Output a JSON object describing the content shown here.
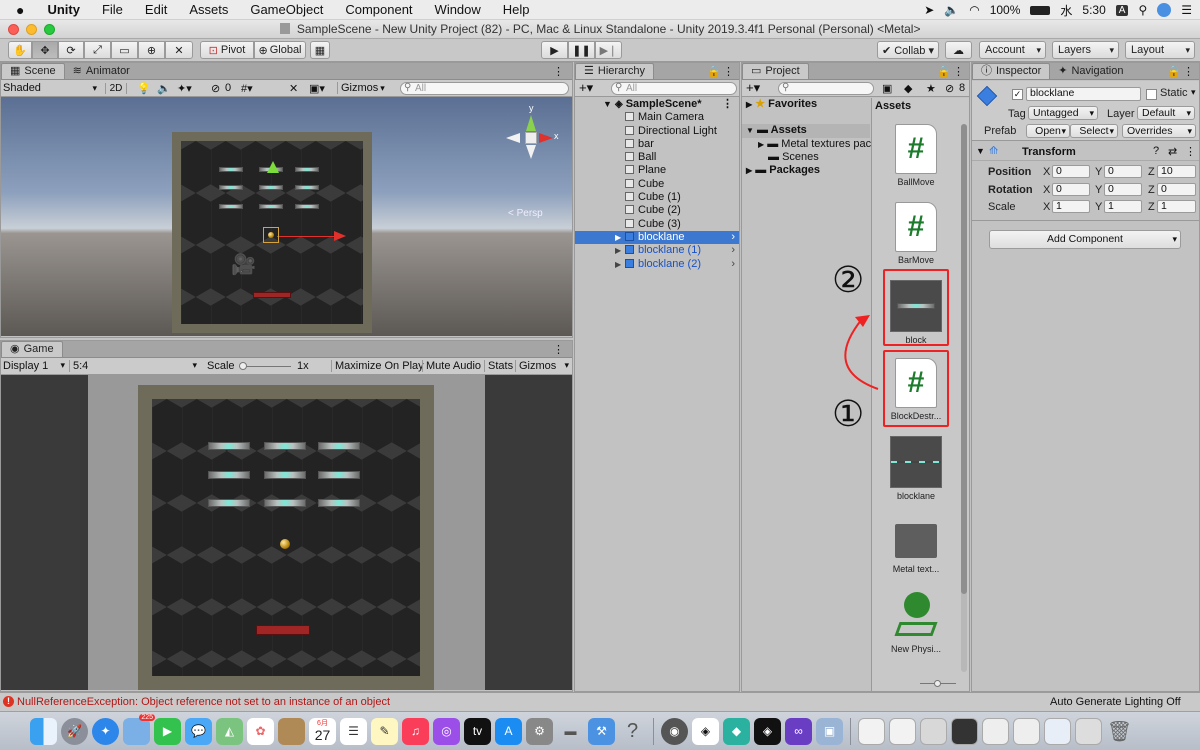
{
  "menubar": {
    "apple": "",
    "items": [
      "Unity",
      "File",
      "Edit",
      "Assets",
      "GameObject",
      "Component",
      "Window",
      "Help"
    ],
    "status": {
      "battery": "100%",
      "day": "水",
      "time": "5:30",
      "input": "A"
    }
  },
  "window": {
    "title": "SampleScene - New Unity Project (82) - PC, Mac & Linux Standalone - Unity 2019.3.4f1 Personal (Personal) <Metal>"
  },
  "toolbar": {
    "pivot": "Pivot",
    "global": "Global",
    "collab": "Collab ▾",
    "account": "Account",
    "layers": "Layers",
    "layout": "Layout"
  },
  "scene_panel": {
    "tabs": [
      "Scene",
      "Animator"
    ],
    "shading": "Shaded",
    "mode_2d": "2D",
    "hidden_count": "0",
    "gizmos": "Gizmos",
    "search_placeholder": "All",
    "persp_label": "< Persp"
  },
  "game_panel": {
    "tab": "Game",
    "display": "Display 1",
    "aspect": "5:4",
    "scale_label": "Scale",
    "scale_value": "1x",
    "maximize": "Maximize On Play",
    "mute": "Mute Audio",
    "stats": "Stats",
    "gizmos": "Gizmos"
  },
  "hierarchy": {
    "tab": "Hierarchy",
    "search_placeholder": "All",
    "scene": "SampleScene*",
    "items": [
      {
        "label": "Main Camera"
      },
      {
        "label": "Directional Light"
      },
      {
        "label": "bar"
      },
      {
        "label": "Ball"
      },
      {
        "label": "Plane"
      },
      {
        "label": "Cube"
      },
      {
        "label": "Cube (1)"
      },
      {
        "label": "Cube (2)"
      },
      {
        "label": "Cube (3)"
      }
    ],
    "prefabs": [
      {
        "label": "blocklane"
      },
      {
        "label": "blocklane (1)"
      },
      {
        "label": "blocklane (2)"
      }
    ]
  },
  "project": {
    "tab": "Project",
    "hidden_count": "8",
    "favorites": "Favorites",
    "assets_root": "Assets",
    "tree": [
      "Metal textures pac",
      "Scenes"
    ],
    "packages": "Packages",
    "grid_title": "Assets",
    "assets": [
      "BallMove",
      "BarMove",
      "block",
      "BlockDestr...",
      "blocklane",
      "Metal text...",
      "New Physi..."
    ],
    "annotations": {
      "first": "①",
      "second": "②"
    }
  },
  "inspector": {
    "tabs": [
      "Inspector",
      "Navigation"
    ],
    "object_name": "blocklane",
    "static_label": "Static",
    "tag_label": "Tag",
    "tag_value": "Untagged",
    "layer_label": "Layer",
    "layer_value": "Default",
    "prefab_label": "Prefab",
    "open": "Open",
    "select": "Select",
    "overrides": "Overrides",
    "transform_title": "Transform",
    "position_label": "Position",
    "rotation_label": "Rotation",
    "scale_label": "Scale",
    "position": {
      "x": "0",
      "y": "0",
      "z": "10"
    },
    "rotation": {
      "x": "0",
      "y": "0",
      "z": "0"
    },
    "scale": {
      "x": "1",
      "y": "1",
      "z": "1"
    },
    "add_component": "Add Component"
  },
  "status": {
    "error": "NullReferenceException: Object reference not set to an instance of an object",
    "lighting": "Auto Generate Lighting Off"
  },
  "dock": {
    "calendar_month": "6月",
    "calendar_day": "27",
    "badge": "225"
  }
}
